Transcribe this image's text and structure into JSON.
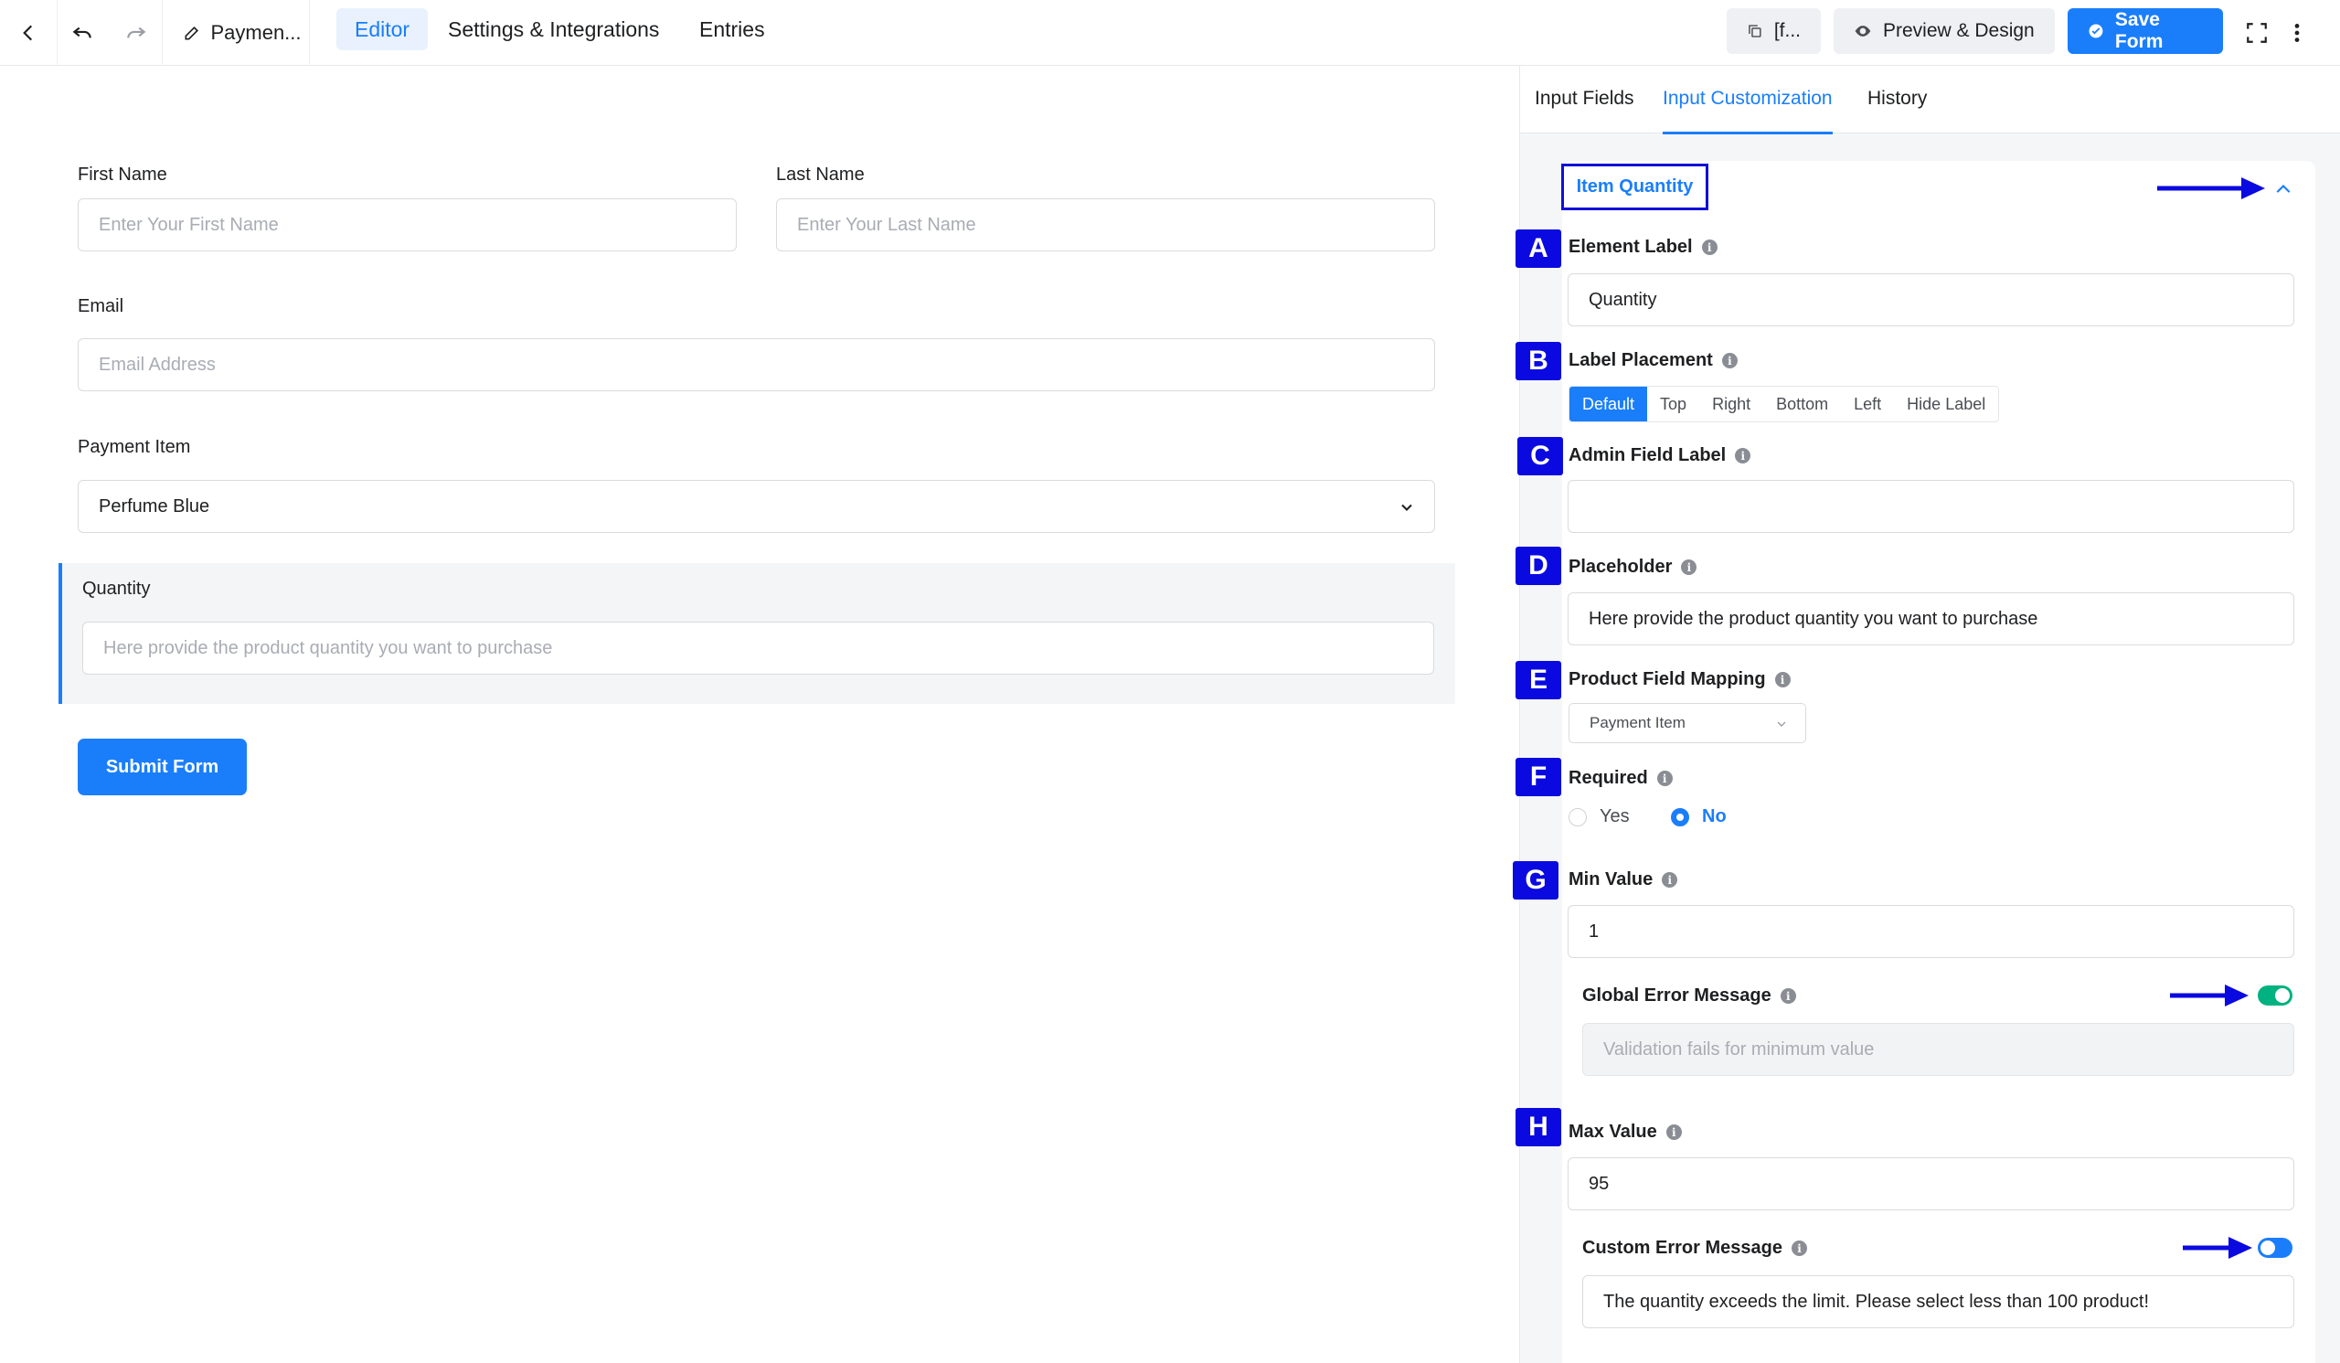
{
  "topbar": {
    "form_name": "Paymen...",
    "nav": [
      "Editor",
      "Settings & Integrations",
      "Entries"
    ],
    "shortcode": "[f...",
    "preview_label": "Preview & Design",
    "save_label": "Save Form"
  },
  "form": {
    "first_name": {
      "label": "First Name",
      "placeholder": "Enter Your First Name"
    },
    "last_name": {
      "label": "Last Name",
      "placeholder": "Enter Your Last Name"
    },
    "email": {
      "label": "Email",
      "placeholder": "Email Address"
    },
    "payment_item": {
      "label": "Payment Item",
      "value": "Perfume Blue"
    },
    "quantity": {
      "label": "Quantity",
      "placeholder": "Here provide the product quantity you want to purchase"
    },
    "submit_label": "Submit Form"
  },
  "sidebar": {
    "tabs": [
      "Input Fields",
      "Input Customization",
      "History"
    ],
    "panel_title": "Item Quantity",
    "badges": [
      "A",
      "B",
      "C",
      "D",
      "E",
      "F",
      "G",
      "H"
    ],
    "element_label": {
      "label": "Element Label",
      "value": "Quantity"
    },
    "label_placement": {
      "label": "Label Placement",
      "options": [
        "Default",
        "Top",
        "Right",
        "Bottom",
        "Left",
        "Hide Label"
      ],
      "selected": "Default"
    },
    "admin_field_label": {
      "label": "Admin Field Label",
      "value": ""
    },
    "placeholder": {
      "label": "Placeholder",
      "value": "Here provide the product quantity you want to purchase"
    },
    "product_field_mapping": {
      "label": "Product Field Mapping",
      "value": "Payment Item"
    },
    "required": {
      "label": "Required",
      "yes": "Yes",
      "no": "No",
      "selected": "No"
    },
    "min_value": {
      "label": "Min Value",
      "value": "1"
    },
    "global_error": {
      "label": "Global Error Message",
      "enabled": true,
      "placeholder": "Validation fails for minimum value"
    },
    "max_value": {
      "label": "Max Value",
      "value": "95"
    },
    "custom_error": {
      "label": "Custom Error Message",
      "enabled": true,
      "value": "The quantity exceeds the limit. Please select less than 100 product!"
    }
  },
  "colors": {
    "accent": "#1a7efb",
    "annotation": "#0a0ae0",
    "toggle_green": "#00b27f"
  }
}
